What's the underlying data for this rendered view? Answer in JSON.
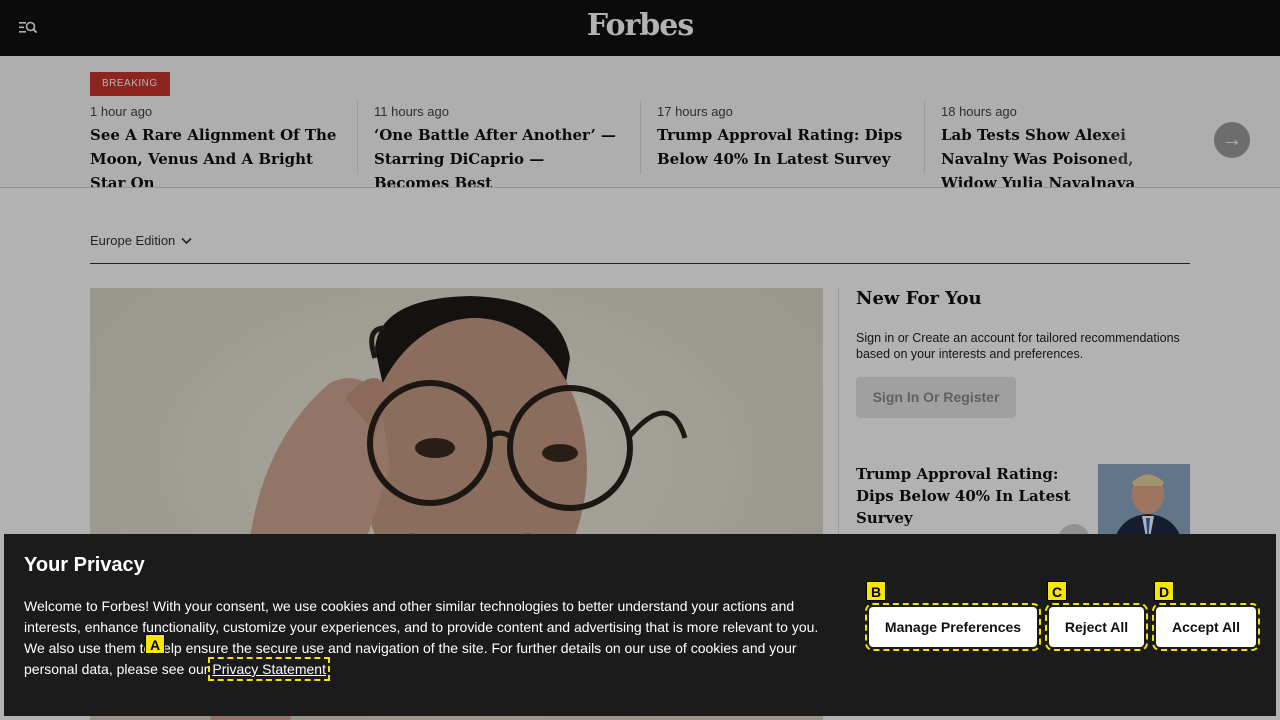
{
  "header": {
    "logo": "Forbes",
    "menu_icon": "menu-search-icon"
  },
  "breaking": {
    "badge": "BREAKING",
    "stories": [
      {
        "time": "1 hour ago",
        "headline": "See A Rare Alignment Of The Moon, Venus And A Bright Star On"
      },
      {
        "time": "11 hours ago",
        "headline": "‘One Battle After Another’ — Starring DiCaprio — Becomes Best"
      },
      {
        "time": "17 hours ago",
        "headline": "Trump Approval Rating: Dips Below 40% In Latest Survey"
      },
      {
        "time": "18 hours ago",
        "headline": "Lab Tests Show Alexei Navalny Was Poisoned, Widow Yulia Navalnaya"
      }
    ],
    "next_icon": "arrow-right-icon"
  },
  "edition": {
    "label": "Europe Edition",
    "icon": "chevron-down-icon"
  },
  "sidebar": {
    "title": "New For You",
    "text": "Sign in or Create an account for tailored recommendations based on your interests and preferences.",
    "signin_label": "Sign In Or Register",
    "rec_title": "Trump Approval Rating: Dips Below 40% In Latest Survey"
  },
  "privacy": {
    "title": "Your Privacy",
    "body": "Welcome to Forbes! With your consent, we use cookies and other similar technologies to better understand your actions and interests, enhance functionality, customize your experiences, and to provide content and advertising that is more relevant to you. We also use them to help ensure the secure use and navigation of the site. For further details on our use of cookies and your personal data, please see our",
    "link": "Privacy Statement",
    "manage_label": "Manage Preferences",
    "reject_label": "Reject All",
    "accept_label": "Accept All"
  },
  "markers": {
    "a": "A",
    "b": "B",
    "c": "C",
    "d": "D"
  },
  "colors": {
    "breaking_badge": "#c8352b",
    "highlight": "#f7e600",
    "banner_bg": "#1b1b1b"
  }
}
